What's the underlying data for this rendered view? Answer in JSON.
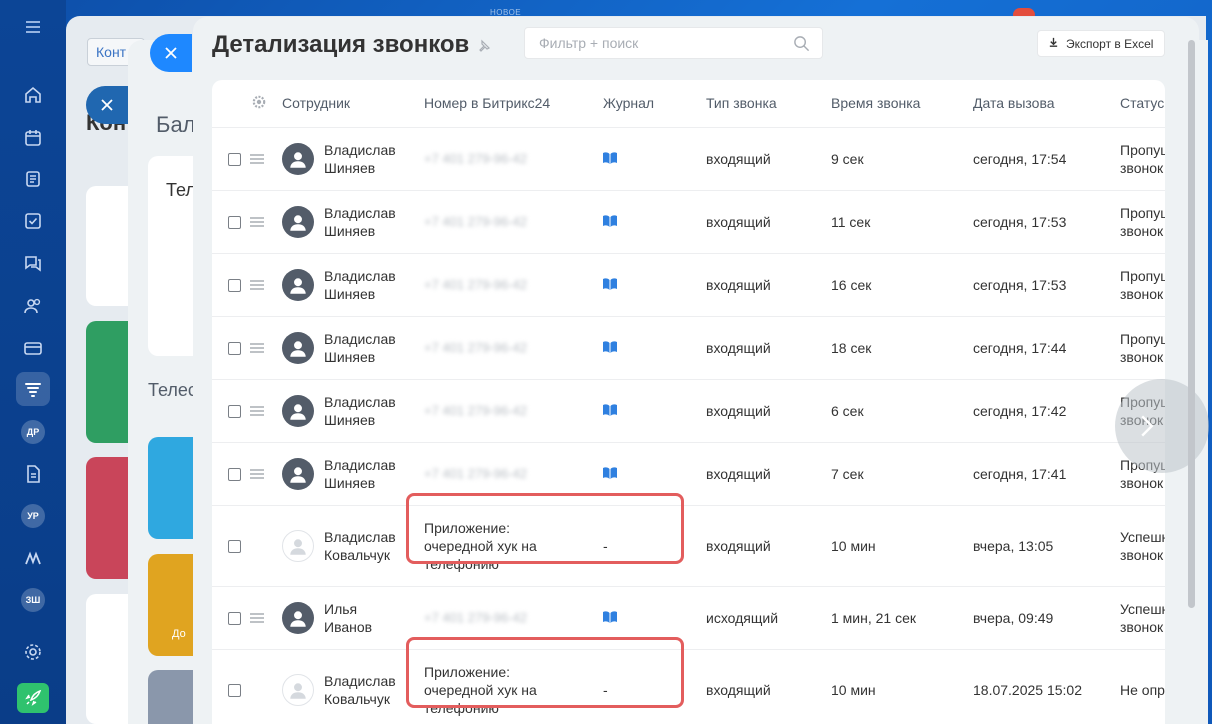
{
  "topbar": {
    "label": "НОВОЕ"
  },
  "sidebar": {
    "badges": [
      "ДР",
      "УР",
      "ЗШ"
    ],
    "icons": [
      "menu-icon",
      "home-icon",
      "calendar-icon",
      "feed-icon",
      "tasks-icon",
      "chat-icon",
      "contacts-icon",
      "crm-card-icon",
      "funnel-icon",
      "badge-dr",
      "document-icon",
      "badge-ur",
      "logo-icon",
      "badge-zsh",
      "settings-icon",
      "rocket-icon"
    ]
  },
  "background": {
    "layer1_tab": "Конт",
    "layer1_title": "Кон",
    "layer2_title": "Бал",
    "layer2_card_title": "Тел",
    "layer2_section": "Телес",
    "layer2_card_label": "До"
  },
  "panel": {
    "title": "Детализация звонков",
    "search_placeholder": "Фильтр + поиск",
    "export_label": "Экспорт в Excel"
  },
  "table": {
    "columns": [
      "Сотрудник",
      "Номер в Битрикс24",
      "Журнал",
      "Тип звонка",
      "Время звонка",
      "Дата вызова",
      "Статус"
    ],
    "rows": [
      {
        "first": "Владислав",
        "last": "Шиняев",
        "number": "+7 401 279-96-42",
        "app": false,
        "journal": "book",
        "type": "входящий",
        "duration": "9 сек",
        "date": "сегодня, 17:54",
        "status1": "Пропущ",
        "status2": "звонок"
      },
      {
        "first": "Владислав",
        "last": "Шиняев",
        "number": "+7 401 279-96-42",
        "app": false,
        "journal": "book",
        "type": "входящий",
        "duration": "11 сек",
        "date": "сегодня, 17:53",
        "status1": "Пропущ",
        "status2": "звонок"
      },
      {
        "first": "Владислав",
        "last": "Шиняев",
        "number": "+7 401 279-96-42",
        "app": false,
        "journal": "book",
        "type": "входящий",
        "duration": "16 сек",
        "date": "сегодня, 17:53",
        "status1": "Пропущ",
        "status2": "звонок"
      },
      {
        "first": "Владислав",
        "last": "Шиняев",
        "number": "+7 401 279-96-42",
        "app": false,
        "journal": "book",
        "type": "входящий",
        "duration": "18 сек",
        "date": "сегодня, 17:44",
        "status1": "Пропущ",
        "status2": "звонок"
      },
      {
        "first": "Владислав",
        "last": "Шиняев",
        "number": "+7 401 279-96-42",
        "app": false,
        "journal": "book",
        "type": "входящий",
        "duration": "6 сек",
        "date": "сегодня, 17:42",
        "status1": "Пропущ",
        "status2": "звонок"
      },
      {
        "first": "Владислав",
        "last": "Шиняев",
        "number": "+7 401 279-96-42",
        "app": false,
        "journal": "book",
        "type": "входящий",
        "duration": "7 сек",
        "date": "сегодня, 17:41",
        "status1": "Пропущ",
        "status2": "звонок"
      },
      {
        "first": "Владислав",
        "last": "Ковальчук",
        "number": "Приложение: очередной хук на телефонию",
        "app": true,
        "journal": "-",
        "type": "входящий",
        "duration": "10 мин",
        "date": "вчера, 13:05",
        "status1": "Успешн",
        "status2": "звонок"
      },
      {
        "first": "Илья",
        "last": "Иванов",
        "number": "+7 401 279-96-42",
        "app": false,
        "journal": "book",
        "type": "исходящий",
        "duration": "1 мин, 21 сек",
        "date": "вчера, 09:49",
        "status1": "Успешн",
        "status2": "звонок"
      },
      {
        "first": "Владислав",
        "last": "Ковальчук",
        "number": "Приложение: очередной хук на телефонию",
        "app": true,
        "journal": "-",
        "type": "входящий",
        "duration": "10 мин",
        "date": "18.07.2025 15:02",
        "status1": "Не опр",
        "status2": ""
      }
    ]
  },
  "colors": {
    "accent": "#1e88ff",
    "highlight": "#e35d5d",
    "journal_icon": "#2f80e0",
    "rocket": "#2fc26e"
  }
}
